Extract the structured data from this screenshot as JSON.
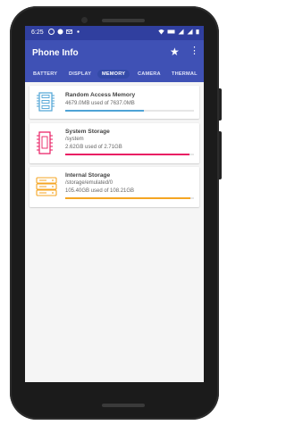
{
  "status_bar": {
    "time": "6:25"
  },
  "app_bar": {
    "title": "Phone Info"
  },
  "tabs": [
    {
      "label": "BATTERY",
      "active": false
    },
    {
      "label": "DISPLAY",
      "active": false
    },
    {
      "label": "MEMORY",
      "active": true
    },
    {
      "label": "CAMERA",
      "active": false
    },
    {
      "label": "THERMAL",
      "active": false
    }
  ],
  "cards": [
    {
      "title": "Random Access Memory",
      "path": "",
      "usage": "4679.0MB used of 7637.0MB",
      "used_fraction": 0.613,
      "color": "#4ea3d6",
      "icon": "ram-icon"
    },
    {
      "title": "System Storage",
      "path": "/system",
      "usage": "2.62GB used of 2.71GB",
      "used_fraction": 0.967,
      "color": "#e91e63",
      "icon": "sd-card-icon"
    },
    {
      "title": "Internal Storage",
      "path": "/storage/emulated/0",
      "usage": "105.40GB used of 108.21GB",
      "used_fraction": 0.974,
      "color": "#f5a623",
      "icon": "storage-drive-icon"
    }
  ]
}
